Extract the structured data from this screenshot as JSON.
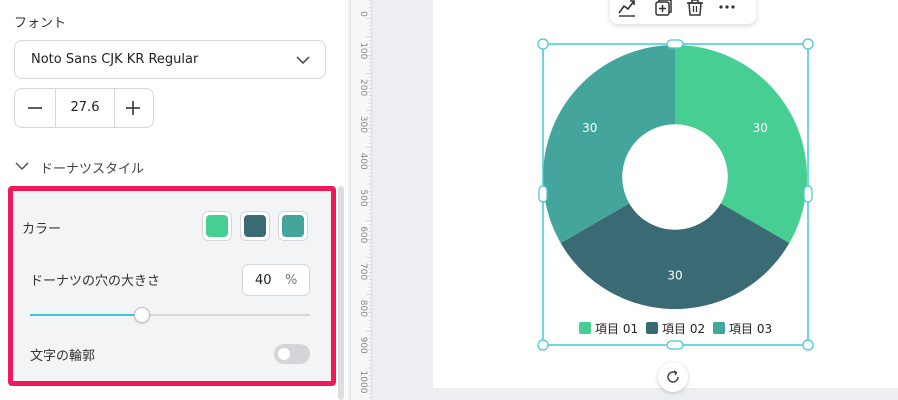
{
  "font": {
    "label": "フォント",
    "family": "Noto Sans CJK KR Regular",
    "size": "27.6"
  },
  "donut_style": {
    "section_label": "ドーナツスタイル",
    "color_label": "カラー",
    "swatches": [
      "#47cf93",
      "#3a6b75",
      "#43a59b"
    ],
    "hole_label": "ドーナツの穴の大きさ",
    "hole_value": "40",
    "hole_unit": "%",
    "hole_fraction": 0.4,
    "outline_label": "文字の輪郭",
    "outline_on": false
  },
  "ruler": {
    "ticks": [
      "0",
      "100",
      "200",
      "300",
      "400",
      "500",
      "600",
      "700",
      "800",
      "900",
      "1000"
    ]
  },
  "colors": {
    "accent": "#3ec6d6",
    "highlight": "#f2195a",
    "selection": "#42c8d8"
  },
  "toolbar": {
    "icons": [
      "chart-analytics-icon",
      "duplicate-icon",
      "delete-icon",
      "more-icon"
    ],
    "more_label": "···"
  },
  "chart_data": {
    "type": "pie",
    "donut": true,
    "categories": [
      "項目 01",
      "項目 02",
      "項目 03"
    ],
    "values": [
      30,
      30,
      30
    ],
    "labels": [
      "30",
      "30",
      "30"
    ],
    "colors": [
      "#47cf93",
      "#3a6b75",
      "#43a59b"
    ],
    "legend_placement": "bottom"
  }
}
